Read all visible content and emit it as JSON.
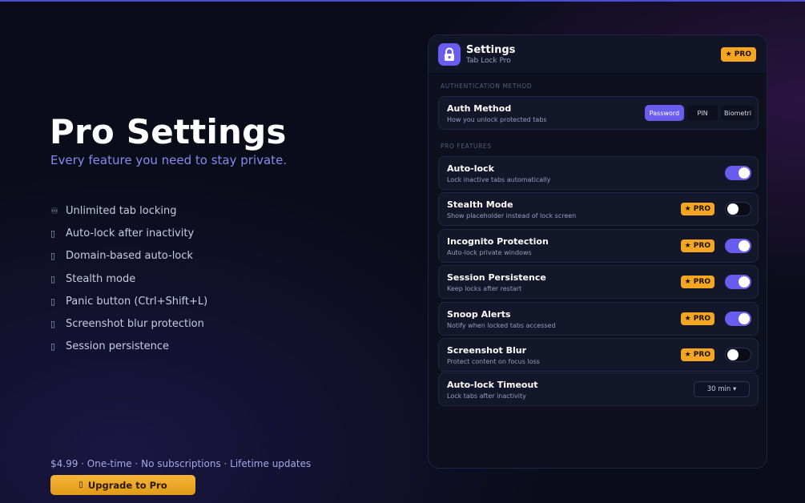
{
  "hero": {
    "title": "Pro Settings",
    "subtitle": "Every feature you need to stay private.",
    "features": [
      {
        "icon": "infinity-icon",
        "glyph": "♾",
        "label": "Unlimited tab locking"
      },
      {
        "icon": "missing-glyph-icon",
        "glyph": "▯",
        "label": "Auto-lock after inactivity"
      },
      {
        "icon": "missing-glyph-icon",
        "glyph": "▯",
        "label": "Domain-based auto-lock"
      },
      {
        "icon": "missing-glyph-icon",
        "glyph": "▯",
        "label": "Stealth mode"
      },
      {
        "icon": "missing-glyph-icon",
        "glyph": "▯",
        "label": "Panic button (Ctrl+Shift+L)"
      },
      {
        "icon": "missing-glyph-icon",
        "glyph": "▯",
        "label": "Screenshot blur protection"
      },
      {
        "icon": "missing-glyph-icon",
        "glyph": "▯",
        "label": "Session persistence"
      }
    ],
    "price_line": "$4.99 · One-time · No subscriptions · Lifetime updates",
    "upgrade_glyph": "▯",
    "upgrade_label": "Upgrade to Pro"
  },
  "panel": {
    "title": "Settings",
    "subtitle": "Tab Lock Pro",
    "pro_badge": "★ PRO",
    "section_auth": "AUTHENTICATION METHOD",
    "section_pro": "PRO FEATURES",
    "auth": {
      "label": "Auth Method",
      "desc": "How you unlock protected tabs",
      "options": [
        "Password",
        "PIN",
        "Biometri"
      ],
      "selected": "Password"
    },
    "rows": [
      {
        "label": "Auto-lock",
        "desc": "Lock inactive tabs automatically",
        "pro": false,
        "on": true
      },
      {
        "label": "Stealth Mode",
        "desc": "Show placeholder instead of lock screen",
        "pro": true,
        "on": false
      },
      {
        "label": "Incognito Protection",
        "desc": "Auto-lock private windows",
        "pro": true,
        "on": true
      },
      {
        "label": "Session Persistence",
        "desc": "Keep locks after restart",
        "pro": true,
        "on": true
      },
      {
        "label": "Snoop Alerts",
        "desc": "Notify when locked tabs accessed",
        "pro": true,
        "on": true
      },
      {
        "label": "Screenshot Blur",
        "desc": "Protect content on focus loss",
        "pro": true,
        "on": false
      }
    ],
    "timeout": {
      "label": "Auto-lock Timeout",
      "desc": "Lock tabs after inactivity",
      "value": "30 min ▾"
    }
  },
  "colors": {
    "accent": "#6b5cf0",
    "pro": "#f3a624",
    "background": "#0a0c1a"
  }
}
